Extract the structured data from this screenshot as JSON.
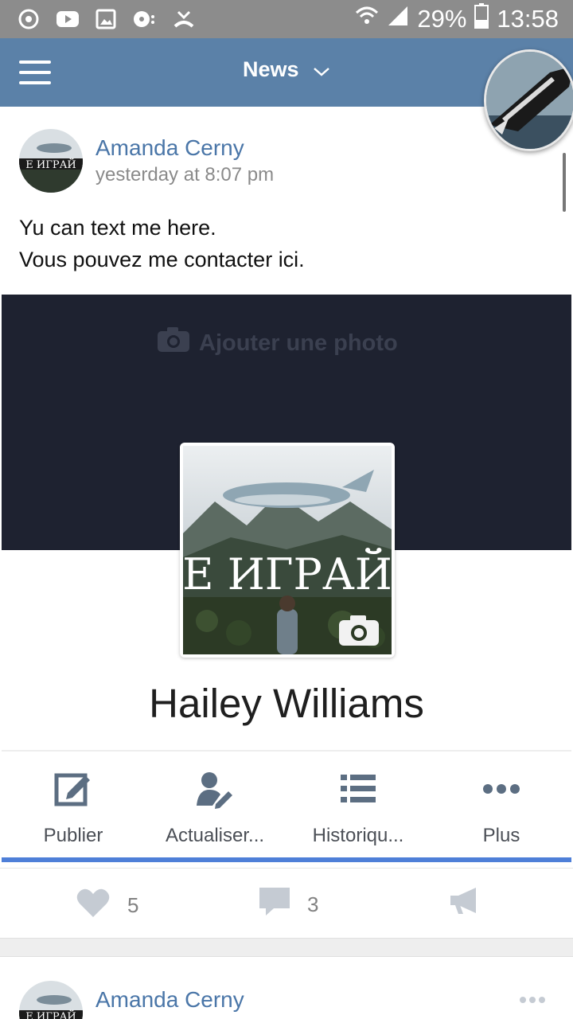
{
  "status_bar": {
    "battery": "29%",
    "time": "13:58",
    "icons": [
      "sync-icon",
      "youtube-icon",
      "gallery-icon",
      "media-icon",
      "missed-call-icon",
      "wifi-icon",
      "signal-icon",
      "battery-icon"
    ]
  },
  "header": {
    "title": "News",
    "menu_icon": "hamburger-icon",
    "dropdown_icon": "chevron-down-icon"
  },
  "post": {
    "author": "Amanda Cerny",
    "time": "yesterday at 8:07 pm",
    "text_line1": "Yu can text me here.",
    "text_line2": "Vous pouvez me contacter ici.",
    "image": {
      "add_photo_label": "Ajouter une photo",
      "profile_name": "Hailey Williams",
      "pic_caption": "E ИГРАЙ",
      "actions": [
        {
          "label": "Publier",
          "icon": "edit-icon"
        },
        {
          "label": "Actualiser...",
          "icon": "user-edit-icon"
        },
        {
          "label": "Historiqu...",
          "icon": "list-icon"
        },
        {
          "label": "Plus",
          "icon": "more-icon"
        }
      ]
    },
    "likes": "5",
    "comments": "3"
  },
  "next_post": {
    "author": "Amanda Cerny"
  },
  "colors": {
    "status_bar": "#8c8c8c",
    "app_bar": "#5b81a8",
    "link": "#4a76a8",
    "cover": "#1e2230",
    "accent_line": "#4e7fd8"
  }
}
